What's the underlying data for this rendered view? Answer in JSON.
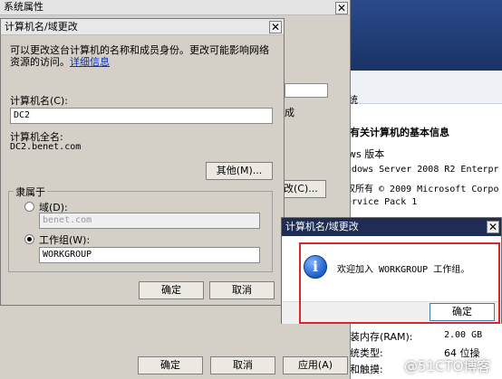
{
  "outer_window": {
    "title": "系统属性",
    "behind_button_suffix": "改(C)...",
    "behind_text_fragment": "成"
  },
  "background_sysinfo": {
    "heading_fragment": "有关计算机的基本信息",
    "edition_label_fragment": "ws 版本",
    "os_name_fragment": "ndows Server 2008 R2 Enterpr",
    "copyright_fragment": "权所有 © 2009 Microsoft Corpo",
    "service_pack_fragment": "ervice Pack 1",
    "ram_label_fragment": "装内存(RAM):",
    "ram_value_fragment": "2.00 GB",
    "systype_label_fragment": "统类型:",
    "systype_value_fragment": "64 位操",
    "pen_label_fragment": "和触摸:",
    "left_fragment": "统",
    "watermark": "@51CTO博客"
  },
  "computer_name_dialog": {
    "title": "计算机名/域更改",
    "description_line1": "可以更改这台计算机的名称和成员身份。更改可能影响网络",
    "description_line2": "资源的访问。",
    "details_link": "详细信息",
    "computer_name_label": "计算机名(C):",
    "computer_name_value": "DC2",
    "full_name_label": "计算机全名:",
    "full_name_value": "DC2.benet.com",
    "more_button": "其他(M)...",
    "member_of_label": "隶属于",
    "domain_label": "域(D):",
    "domain_value": "benet.com",
    "workgroup_label": "工作组(W):",
    "workgroup_value": "WORKGROUP",
    "ok_button": "确定",
    "cancel_button": "取消"
  },
  "bottom_buttons": {
    "ok": "确定",
    "cancel": "取消",
    "apply": "应用(A)"
  },
  "welcome_dialog": {
    "title": "计算机名/域更改",
    "message": "欢迎加入 WORKGROUP 工作组。",
    "ok_button": "确定"
  },
  "colors": {
    "dialog_bg": "#d4d0c8",
    "title_dark": "#1f2d55",
    "highlight_red": "#d9262b",
    "info_blue": "#1d5fc4"
  }
}
